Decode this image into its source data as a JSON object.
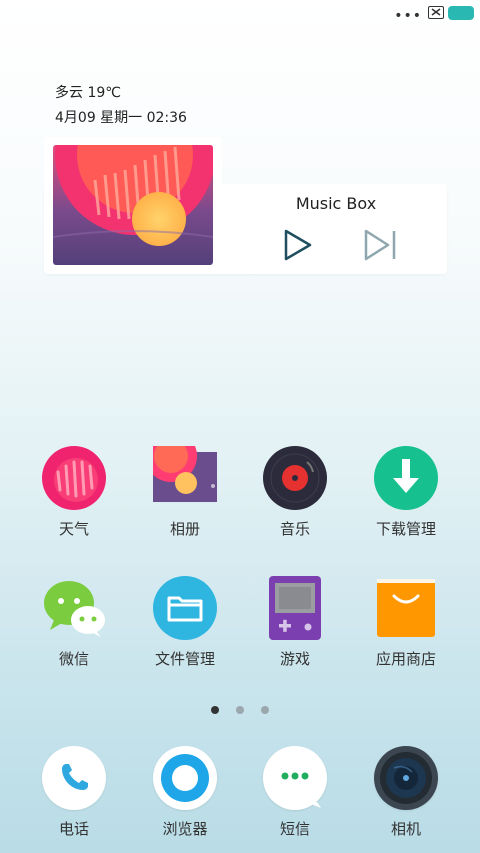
{
  "status": {
    "dots": "•••"
  },
  "widget": {
    "weather": "多云 19℃",
    "datetime": "4月09 星期一 02:36"
  },
  "music": {
    "title": "Music Box"
  },
  "apps": [
    {
      "label": "天气",
      "icon": "weather-icon"
    },
    {
      "label": "相册",
      "icon": "gallery-icon"
    },
    {
      "label": "音乐",
      "icon": "music-icon"
    },
    {
      "label": "下载管理",
      "icon": "download-icon"
    },
    {
      "label": "微信",
      "icon": "wechat-icon"
    },
    {
      "label": "文件管理",
      "icon": "folder-icon"
    },
    {
      "label": "游戏",
      "icon": "game-icon"
    },
    {
      "label": "应用商店",
      "icon": "app-store-icon"
    }
  ],
  "dock": [
    {
      "label": "电话",
      "icon": "phone-icon"
    },
    {
      "label": "浏览器",
      "icon": "browser-icon"
    },
    {
      "label": "短信",
      "icon": "sms-icon"
    },
    {
      "label": "相机",
      "icon": "camera-icon"
    }
  ],
  "pages": {
    "count": 3,
    "active": 1
  },
  "colors": {
    "accent": "#2ab8b3",
    "weather": "#f0246e",
    "download": "#16c08f",
    "folder": "#2fb6e0",
    "game": "#7b3fb0",
    "store": "#ff9800",
    "wechat": "#7bcc3f"
  }
}
